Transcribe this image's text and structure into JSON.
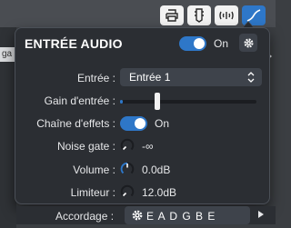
{
  "toolbar": {
    "buttons": [
      {
        "icon": "printer-icon"
      },
      {
        "icon": "guitar-headstock-icon"
      },
      {
        "icon": "tuner-icon"
      },
      {
        "icon": "cable-input-icon",
        "active": true
      }
    ]
  },
  "background": {
    "left_tab_text": "ga"
  },
  "panel": {
    "title": "ENTRÉE AUDIO",
    "power": {
      "state": "On",
      "enabled": true
    },
    "rows": {
      "input": {
        "label": "Entrée :",
        "value": "Entrée 1"
      },
      "gain": {
        "label": "Gain d'entrée :",
        "level": 0.27
      },
      "fx_chain": {
        "label": "Chaîne d'effets :",
        "state": "On",
        "enabled": true
      },
      "noise_gate": {
        "label": "Noise gate :",
        "value": "-∞"
      },
      "volume": {
        "label": "Volume :",
        "value": "0.0dB"
      },
      "limiter": {
        "label": "Limiteur :",
        "value": "12.0dB"
      }
    }
  },
  "tuning": {
    "label": "Accordage :",
    "value": "E A D G B E"
  },
  "colors": {
    "accent": "#2e77c8",
    "panel_bg": "#2b2e33",
    "field_bg": "#3e434b"
  }
}
